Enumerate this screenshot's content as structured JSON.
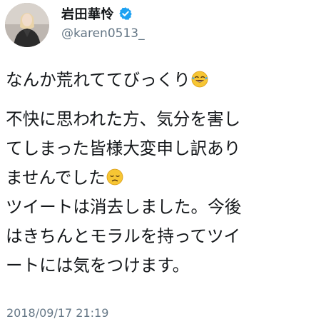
{
  "user": {
    "display_name": "岩田華怜",
    "handle": "@karen0513_",
    "verified_icon": "verified-badge-icon",
    "avatar_icon": "profile-photo"
  },
  "tweet": {
    "line_1": "なんか荒れててびっくり",
    "line_1_emoji": "face-with-tears-of-joy-emoji",
    "line_2": "不快に思われた方、気分を害し",
    "line_3": "てしまった皆様大変申し訳あり",
    "line_4": "ませんでした",
    "line_4_emoji": "disappointed-face-emoji",
    "line_5": "ツイートは消去しました。今後",
    "line_6": "はきちんとモラルを持ってツイ",
    "line_7": "ートには気をつけます。"
  },
  "timestamp": "2018/09/17 21:19",
  "colors": {
    "text": "#14171a",
    "secondary_text": "#657786",
    "verified_blue": "#1da1f2",
    "background": "#ffffff"
  }
}
